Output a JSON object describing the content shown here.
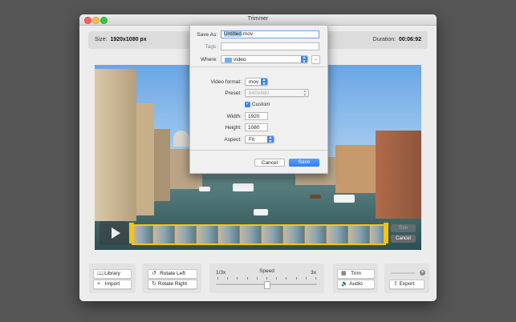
{
  "window": {
    "title": "Trimmer"
  },
  "infobar": {
    "size_label": "Size:",
    "size_value": "1920x1080 px",
    "duration_label": "Duration:",
    "duration_value": "00:06:92"
  },
  "video": {
    "trim_label": "Trim",
    "cancel_label": "Cancel"
  },
  "toolbar": {
    "library_label": "Library",
    "import_label": "Import",
    "rotate_left_label": "Rotate Left",
    "rotate_right_label": "Rotate Right",
    "speed_label": "Speed",
    "speed_min": "1/3x",
    "speed_max": "3x",
    "speed_value": 0.5,
    "trim_label": "Trim",
    "audio_label": "Audio",
    "export_label": "Export"
  },
  "save_sheet": {
    "save_as_label": "Save As:",
    "save_as_value": "Untitled.mov",
    "save_as_selected": "Untitled",
    "save_as_ext": ".mov",
    "tags_label": "Tags:",
    "tags_value": "",
    "where_label": "Where:",
    "where_value": "video",
    "video_format_label": "Video format:",
    "video_format_value": "mov",
    "preset_label": "Preset:",
    "preset_value": "640x480",
    "custom_label": "Custom",
    "custom_checked": true,
    "width_label": "Width:",
    "width_value": "1920",
    "height_label": "Height:",
    "height_value": "1080",
    "aspect_label": "Aspect:",
    "aspect_value": "Fit",
    "cancel_label": "Cancel",
    "save_label": "Save"
  },
  "colors": {
    "accent": "#3a83f3",
    "trim_handle": "#f6c412",
    "desktop": "#555555"
  },
  "icons": [
    "book-icon",
    "plus-icon",
    "rotate-left-icon",
    "rotate-right-icon",
    "trim-icon",
    "speaker-icon",
    "share-icon",
    "close-circle-icon",
    "play-icon",
    "folder-icon",
    "check-icon"
  ]
}
